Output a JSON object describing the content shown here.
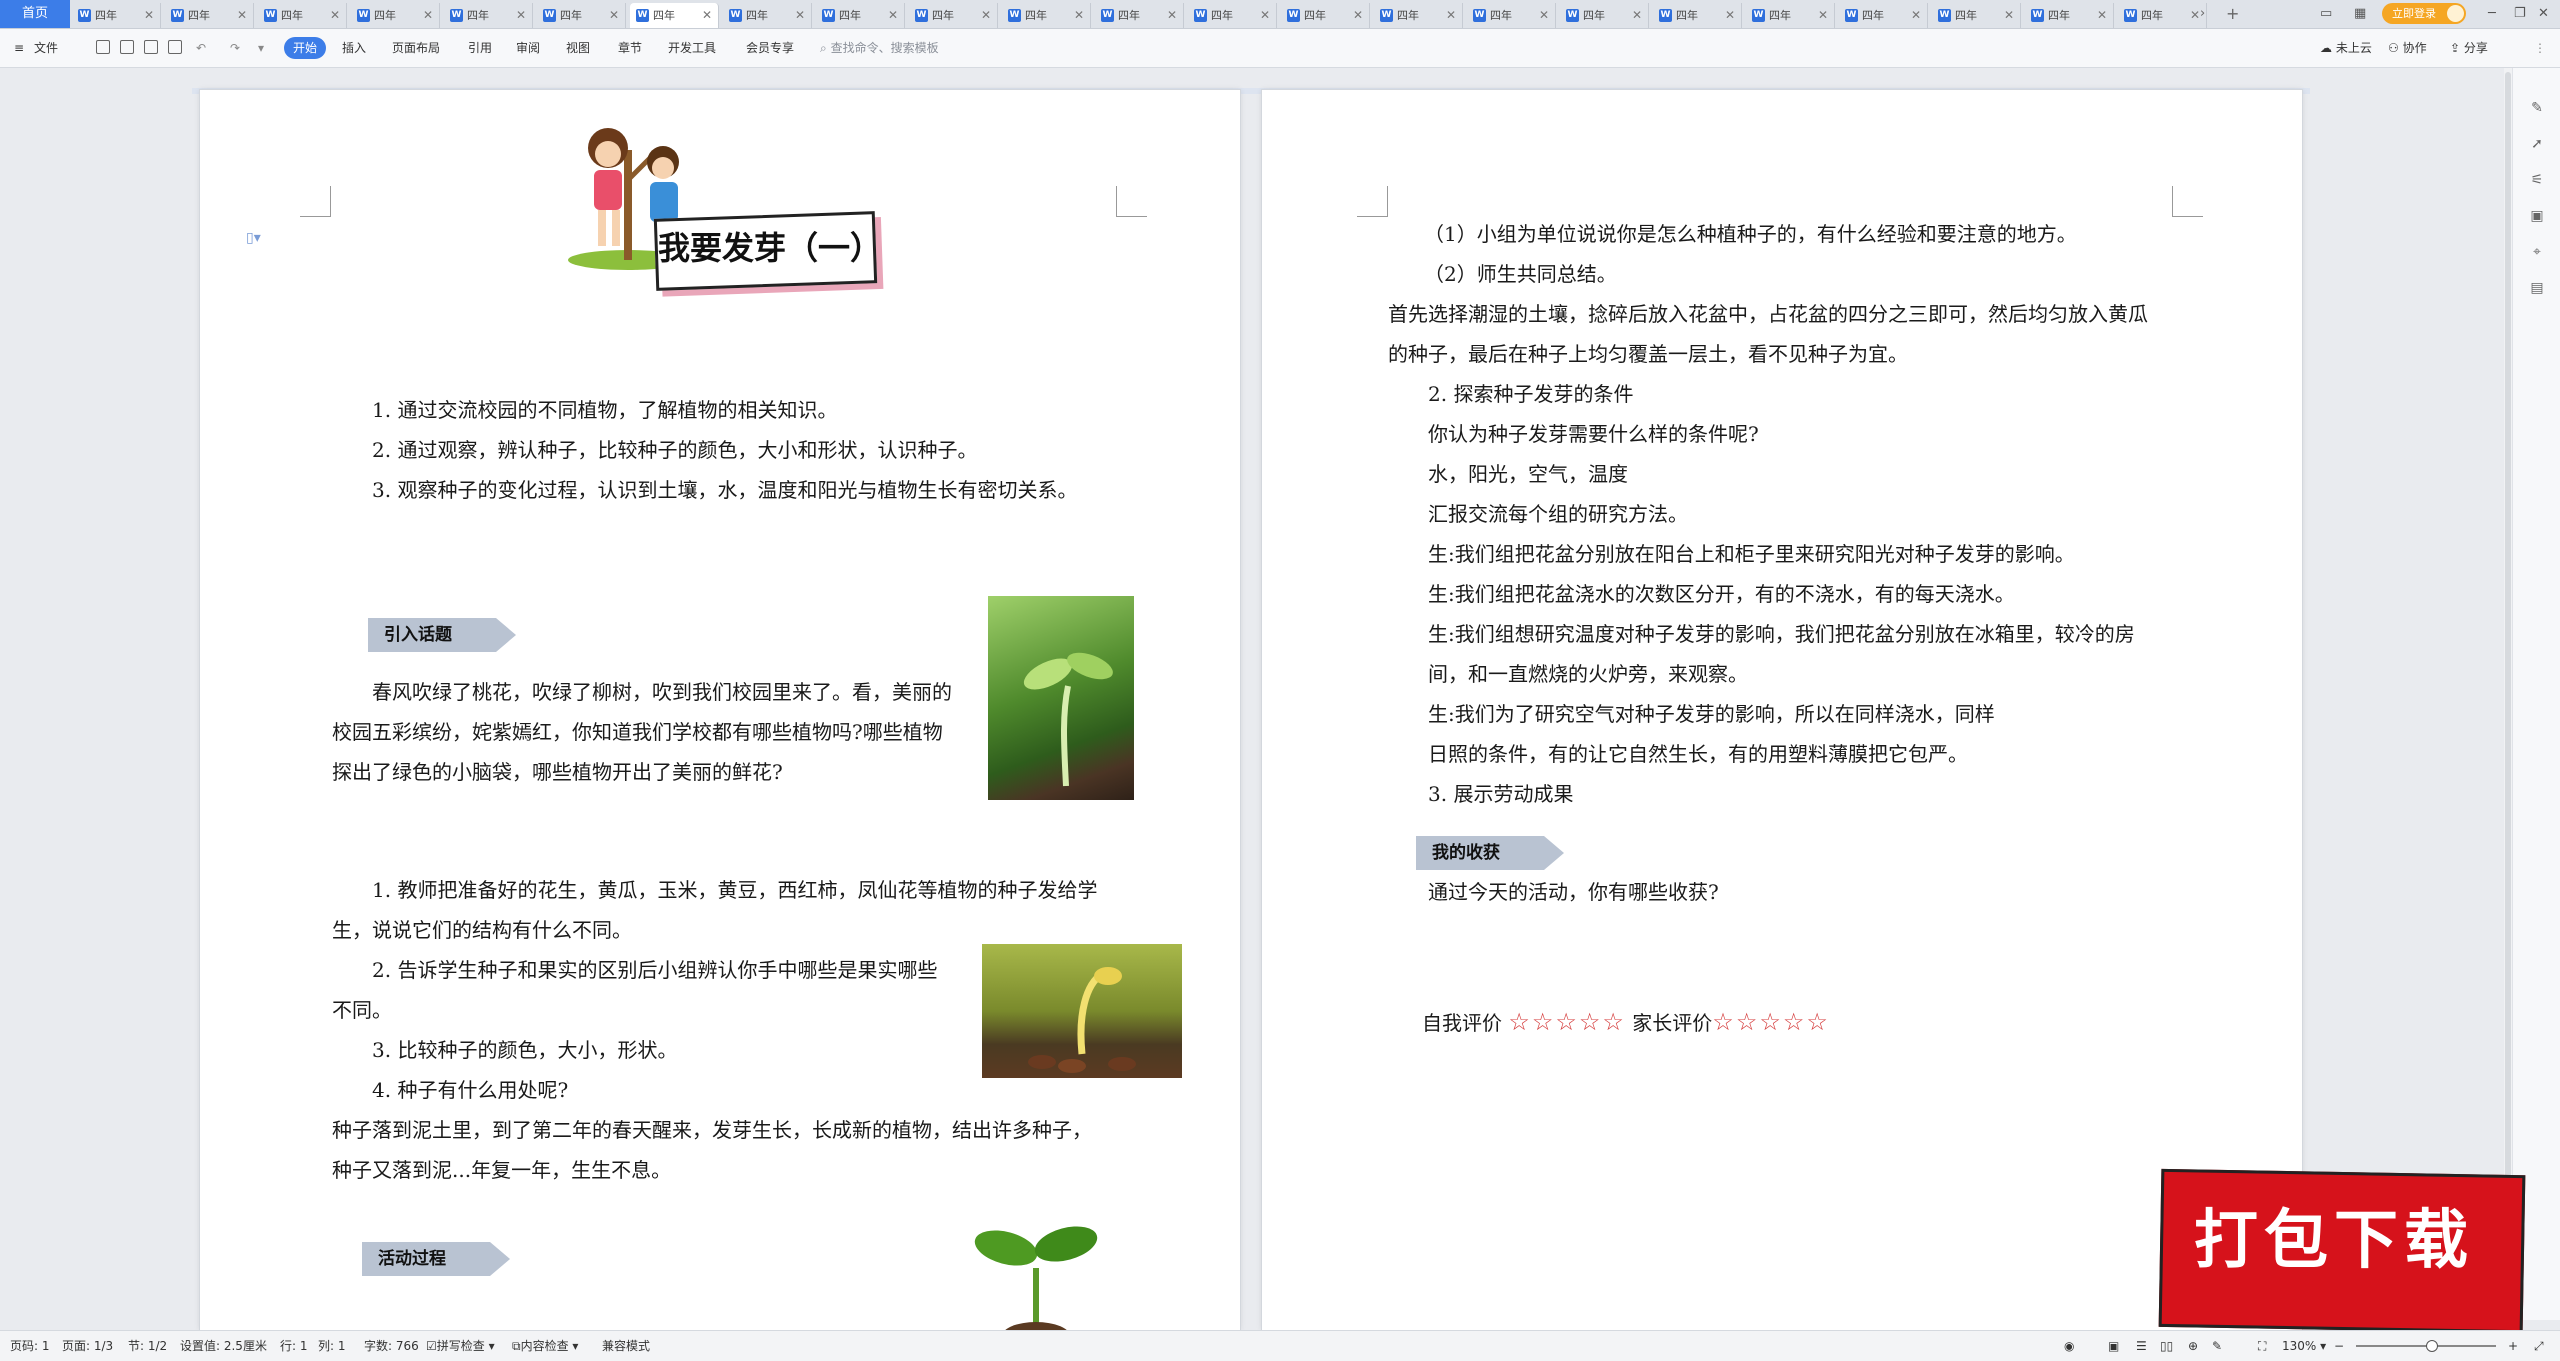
{
  "tabs": {
    "home": "首页",
    "doc_title": "四年",
    "count": 23,
    "active_index": 6,
    "more": "›",
    "add": "+"
  },
  "account": {
    "login": "立即登录"
  },
  "toolbar": {
    "file": "文件",
    "menu": [
      "开始",
      "插入",
      "页面布局",
      "引用",
      "审阅",
      "视图",
      "章节",
      "开发工具",
      "会员专享"
    ],
    "search_placeholder": "查找命令、搜索模板",
    "cloud": "未上云",
    "collab": "协作",
    "share": "分享"
  },
  "left_page": {
    "title": "我要发芽（一）",
    "goals": [
      "1. 通过交流校园的不同植物，了解植物的相关知识。",
      "2. 通过观察，辨认种子，比较种子的颜色，大小和形状，认识种子。",
      "3. 观察种子的变化过程，认识到土壤，水，温度和阳光与植物生长有密切关系。"
    ],
    "section1": "引入话题",
    "intro": [
      "春风吹绿了桃花，吹绿了柳树，吹到我们校园里来了。看，美丽的",
      "校园五彩缤纷，姹紫嫣红，你知道我们学校都有哪些植物吗?哪些植物",
      "探出了绿色的小脑袋，哪些植物开出了美丽的鲜花?"
    ],
    "steps": [
      "1. 教师把准备好的花生，黄瓜，玉米，黄豆，西红柿，凤仙花等植物的种子发给学",
      "生，说说它们的结构有什么不同。",
      "2. 告诉学生种子和果实的区别后小组辨认你手中哪些是果实哪些",
      "不同。",
      "3. 比较种子的颜色，大小，形状。",
      "4. 种子有什么用处呢?",
      "种子落到泥土里，到了第二年的春天醒来，发芽生长，长成新的植物，结出许多种子，",
      "种子又落到泥...年复一年，生生不息。"
    ],
    "section2": "活动过程"
  },
  "right_page": {
    "lines": [
      "（1）小组为单位说说你是怎么种植种子的，有什么经验和要注意的地方。",
      "（2）师生共同总结。",
      "首先选择潮湿的土壤，捻碎后放入花盆中，占花盆的四分之三即可，然后均匀放入黄瓜",
      "的种子，最后在种子上均匀覆盖一层土，看不见种子为宜。",
      "2. 探索种子发芽的条件",
      "你认为种子发芽需要什么样的条件呢?",
      "水，阳光，空气，温度",
      "汇报交流每个组的研究方法。",
      "生:我们组把花盆分别放在阳台上和柜子里来研究阳光对种子发芽的影响。",
      "生:我们组把花盆浇水的次数区分开，有的不浇水，有的每天浇水。",
      "生:我们组想研究温度对种子发芽的影响，我们把花盆分别放在冰箱里，较冷的房",
      "间，和一直燃烧的火炉旁，来观察。",
      "生:我们为了研究空气对种子发芽的影响，所以在同样浇水，同样",
      "日照的条件，有的让它自然生长，有的用塑料薄膜把它包严。",
      "3. 展示劳动成果"
    ],
    "section3": "我的收获",
    "harvest": "通过今天的活动，你有哪些收获?",
    "self_eval": "自我评价",
    "parent_eval": "家长评价",
    "stars": "☆☆☆☆☆"
  },
  "status": {
    "page_code": "页码: 1",
    "pages": "页面: 1/3",
    "section": "节: 1/2",
    "setting": "设置值: 2.5厘米",
    "row": "行: 1",
    "col": "列: 1",
    "words": "字数: 766",
    "spell": "拼写检查",
    "content": "内容检查",
    "compat": "兼容模式",
    "zoom": "130%"
  },
  "promo": {
    "text": "打包下载"
  }
}
